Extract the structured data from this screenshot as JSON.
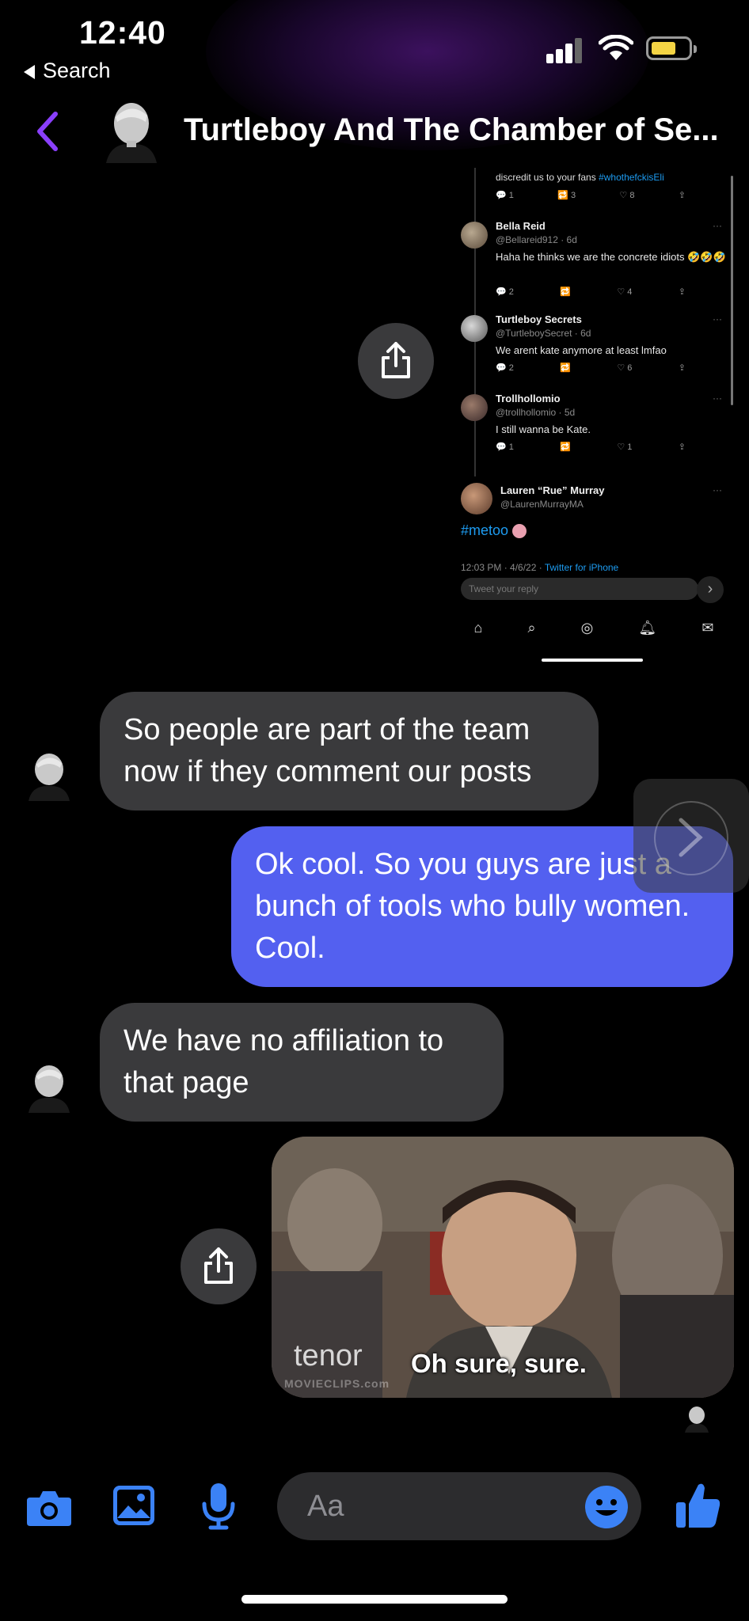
{
  "status_bar": {
    "time": "12:40",
    "back_app": "Search"
  },
  "header": {
    "title": "Turtleboy And The Chamber of Se..."
  },
  "screenshot": {
    "top_text": "discredit us to your fans ",
    "top_hashtag": "#whothefckisEli",
    "top_counts": {
      "replies": "1",
      "retweets": "3",
      "likes": "8"
    },
    "tweets": [
      {
        "name": "Bella Reid",
        "handle": "@Bellareid912 · 6d",
        "text": "Haha he thinks we are the concrete idiots 🤣🤣🤣",
        "replies": "2",
        "retweets": "",
        "likes": "4"
      },
      {
        "name": "Turtleboy Secrets",
        "handle": "@TurtleboySecret · 6d",
        "text": "We arent kate anymore at least lmfao",
        "replies": "2",
        "retweets": "",
        "likes": "6"
      },
      {
        "name": "Trollhollomio",
        "handle": "@trollhollomio · 5d",
        "text": "I still wanna be Kate.",
        "replies": "1",
        "retweets": "",
        "likes": "1"
      }
    ],
    "author": {
      "name": "Lauren “Rue” Murray",
      "handle": "@LaurenMurrayMA"
    },
    "hashtag": "#metoo",
    "timestamp": "12:03 PM · 4/6/22 · ",
    "source": "Twitter for iPhone",
    "reply_placeholder": "Tweet your reply"
  },
  "messages": [
    {
      "direction": "in",
      "text": "So people are part of the team now if they comment our posts"
    },
    {
      "direction": "out",
      "text": "Ok cool. So you guys are just a bunch of tools who bully women. Cool."
    },
    {
      "direction": "in",
      "text": "We have no affiliation to that page"
    }
  ],
  "gif": {
    "caption": "Oh sure, sure.",
    "logo": "tenor",
    "watermark": "MOVIECLIPS.com"
  },
  "composer": {
    "placeholder": "Aa"
  },
  "colors": {
    "accent": "#5360f0",
    "icon_blue": "#3b82f6",
    "back_purple": "#8a3ffc",
    "incoming_bubble": "#3a3a3c"
  }
}
